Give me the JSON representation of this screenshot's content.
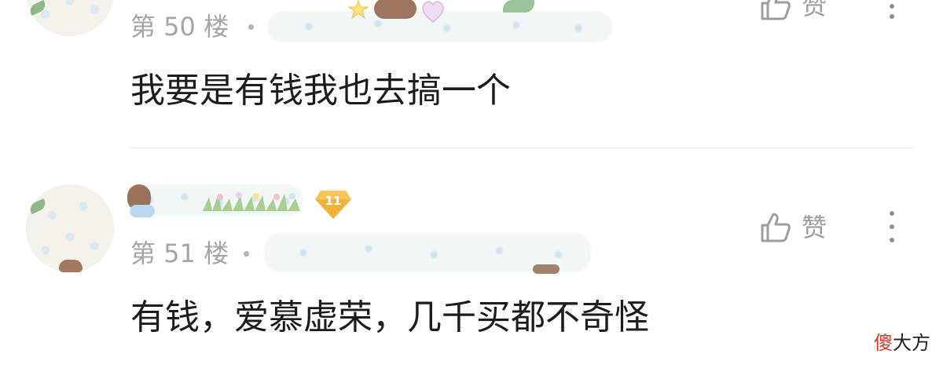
{
  "comments": [
    {
      "floor": "第 50 楼",
      "content": "我要是有钱我也去搞一个",
      "like_label": "赞"
    },
    {
      "floor": "第 51 楼",
      "content": "有钱，爱慕虚荣，几千买都不奇怪",
      "like_label": "赞",
      "level": "11"
    }
  ],
  "icons": {
    "like": "thumbs-up-icon",
    "more": "more-vertical-icon",
    "level": "diamond-level-badge-icon"
  },
  "colors": {
    "meta_text": "#a5a5a5",
    "content_text": "#1c1c1c",
    "level_badge": "#f2b33d"
  },
  "watermark": {
    "first": "傻",
    "rest": "大方"
  }
}
